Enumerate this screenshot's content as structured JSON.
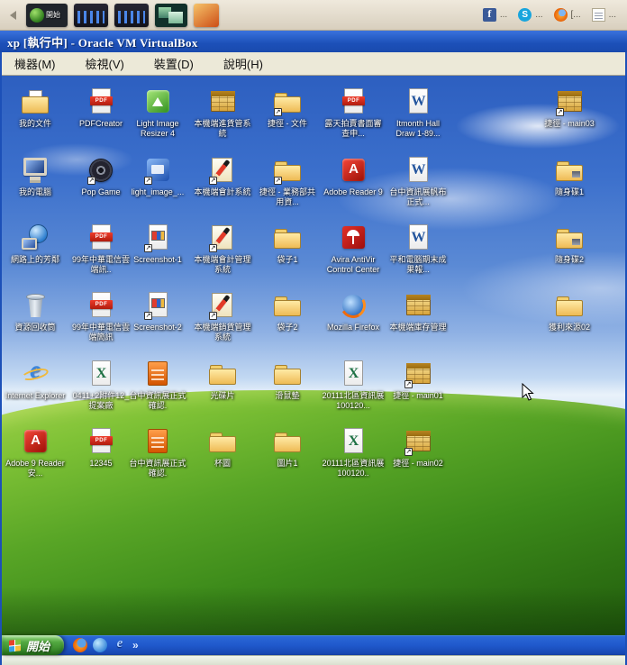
{
  "host_bar": {
    "left_items": [
      {
        "icon": "start-orb",
        "label": "開始"
      },
      {
        "icon": "equalizer",
        "label": ""
      },
      {
        "icon": "equalizer",
        "label": ""
      },
      {
        "icon": "screens",
        "label": ""
      },
      {
        "icon": "photo",
        "label": ""
      }
    ],
    "right_items": [
      {
        "icon": "facebook",
        "label": "..."
      },
      {
        "icon": "skype",
        "label": "..."
      },
      {
        "icon": "firefox",
        "label": "[..."
      },
      {
        "icon": "document",
        "label": "..."
      }
    ]
  },
  "titlebar": {
    "title": "xp [執行中] - Oracle VM VirtualBox"
  },
  "menubar": {
    "items": [
      "機器(M)",
      "檢視(V)",
      "裝置(D)",
      "說明(H)"
    ]
  },
  "colors": {
    "titlebar_blue": "#1c50b8",
    "taskbar_blue": "#2059cc",
    "start_green": "#3d8f2e",
    "sky_blue": "#3c70cc",
    "grass_green": "#58a526",
    "menubar_bg": "#ece9d8",
    "hostbar_bg": "#ded5c4"
  },
  "desktop": {
    "icons": [
      {
        "label": "我的文件",
        "type": "mydocs",
        "row": 0,
        "col": 0,
        "shortcut": false
      },
      {
        "label": "PDFCreator",
        "type": "pdf",
        "row": 0,
        "col": 1,
        "shortcut": false
      },
      {
        "label": "Light Image Resizer 4",
        "type": "app-green",
        "row": 0,
        "col": 2,
        "shortcut": false
      },
      {
        "label": "本機端進貨管系統",
        "type": "ledger",
        "row": 0,
        "col": 3,
        "shortcut": false
      },
      {
        "label": "捷徑 - 文件",
        "type": "folder",
        "row": 0,
        "col": 4,
        "shortcut": true
      },
      {
        "label": "露天拍賣書面審查申...",
        "type": "pdf",
        "row": 0,
        "col": 5,
        "shortcut": false
      },
      {
        "label": "Itmonth Hall Draw 1-89...",
        "type": "word",
        "row": 0,
        "col": 6,
        "shortcut": false
      },
      {
        "label": "捷徑 - main03",
        "type": "ledger",
        "row": 0,
        "col": 7,
        "shortcut": true
      },
      {
        "label": "我的電腦",
        "type": "computer",
        "row": 1,
        "col": 0,
        "shortcut": false
      },
      {
        "label": "Pop Game",
        "type": "disc",
        "row": 1,
        "col": 1,
        "shortcut": true
      },
      {
        "label": "light_image_...",
        "type": "app-blue",
        "row": 1,
        "col": 2,
        "shortcut": true
      },
      {
        "label": "本機端會計系統",
        "type": "ledger-pen",
        "row": 1,
        "col": 3,
        "shortcut": true
      },
      {
        "label": "捷徑 - 業務部共用資...",
        "type": "folder",
        "row": 1,
        "col": 4,
        "shortcut": true
      },
      {
        "label": "Adobe Reader 9",
        "type": "adobe",
        "row": 1,
        "col": 5,
        "shortcut": false
      },
      {
        "label": "台中資訊展帆布正式...",
        "type": "word",
        "row": 1,
        "col": 6,
        "shortcut": false
      },
      {
        "label": "隨身碟1",
        "type": "folder-drive",
        "row": 1,
        "col": 7,
        "shortcut": false
      },
      {
        "label": "網路上的芳鄰",
        "type": "network",
        "row": 2,
        "col": 0,
        "shortcut": false
      },
      {
        "label": "99年中華電信雲端訊..",
        "type": "pdf",
        "row": 2,
        "col": 1,
        "shortcut": false
      },
      {
        "label": "Screenshot-1",
        "type": "image-app",
        "row": 2,
        "col": 2,
        "shortcut": true
      },
      {
        "label": "本機端會計管理系統",
        "type": "ledger-pen",
        "row": 2,
        "col": 3,
        "shortcut": true
      },
      {
        "label": "袋子1",
        "type": "folder",
        "row": 2,
        "col": 4,
        "shortcut": false
      },
      {
        "label": "Avira AntiVir Control Center",
        "type": "avira",
        "row": 2,
        "col": 5,
        "shortcut": false
      },
      {
        "label": "平和電腦期末成果報...",
        "type": "word",
        "row": 2,
        "col": 6,
        "shortcut": false
      },
      {
        "label": "隨身碟2",
        "type": "folder-drive",
        "row": 2,
        "col": 7,
        "shortcut": false
      },
      {
        "label": "資源回收筒",
        "type": "recycle",
        "row": 3,
        "col": 0,
        "shortcut": false
      },
      {
        "label": "99年中華電信雲端簡訊",
        "type": "pdf",
        "row": 3,
        "col": 1,
        "shortcut": false
      },
      {
        "label": "Screenshot-2",
        "type": "image-app",
        "row": 3,
        "col": 2,
        "shortcut": true
      },
      {
        "label": "本機端銷貨管理系統",
        "type": "ledger-pen",
        "row": 3,
        "col": 3,
        "shortcut": true
      },
      {
        "label": "袋子2",
        "type": "folder",
        "row": 3,
        "col": 4,
        "shortcut": false
      },
      {
        "label": "Mozilla Firefox",
        "type": "firefox",
        "row": 3,
        "col": 5,
        "shortcut": false
      },
      {
        "label": "本機端庫存管理",
        "type": "ledger",
        "row": 3,
        "col": 6,
        "shortcut": false
      },
      {
        "label": "獲利來源02",
        "type": "folder",
        "row": 3,
        "col": 7,
        "shortcut": false
      },
      {
        "label": "Internet Explorer",
        "type": "ie",
        "row": 4,
        "col": 0,
        "shortcut": false
      },
      {
        "label": "0411+2附件12_提案廠",
        "type": "excel",
        "row": 4,
        "col": 1,
        "shortcut": false
      },
      {
        "label": "台中資訊展正式確認.",
        "type": "doc-orange",
        "row": 4,
        "col": 2,
        "shortcut": false
      },
      {
        "label": "光碟片",
        "type": "folder",
        "row": 4,
        "col": 3,
        "shortcut": false
      },
      {
        "label": "滑鼠墊",
        "type": "folder",
        "row": 4,
        "col": 4,
        "shortcut": false
      },
      {
        "label": "20111北區資訊展100120...",
        "type": "excel",
        "row": 4,
        "col": 5,
        "shortcut": false
      },
      {
        "label": "捷徑 - main01",
        "type": "ledger",
        "row": 4,
        "col": 6,
        "shortcut": true
      },
      {
        "label": "Adobe 9 Reader 安...",
        "type": "adobe",
        "row": 5,
        "col": 0,
        "shortcut": false
      },
      {
        "label": "12345",
        "type": "pdf",
        "row": 5,
        "col": 1,
        "shortcut": false
      },
      {
        "label": "台中資訊展正式確認.",
        "type": "doc-orange",
        "row": 5,
        "col": 2,
        "shortcut": false
      },
      {
        "label": "杯圖",
        "type": "folder",
        "row": 5,
        "col": 3,
        "shortcut": false
      },
      {
        "label": "圖片1",
        "type": "folder",
        "row": 5,
        "col": 4,
        "shortcut": false
      },
      {
        "label": "20111北區資訊展100120..",
        "type": "excel",
        "row": 5,
        "col": 5,
        "shortcut": false
      },
      {
        "label": "捷徑 - main02",
        "type": "ledger",
        "row": 5,
        "col": 6,
        "shortcut": true
      }
    ]
  },
  "taskbar": {
    "start_label": "開始",
    "quick_launch": [
      "firefox",
      "globe",
      "ie"
    ],
    "chevron": "»"
  }
}
